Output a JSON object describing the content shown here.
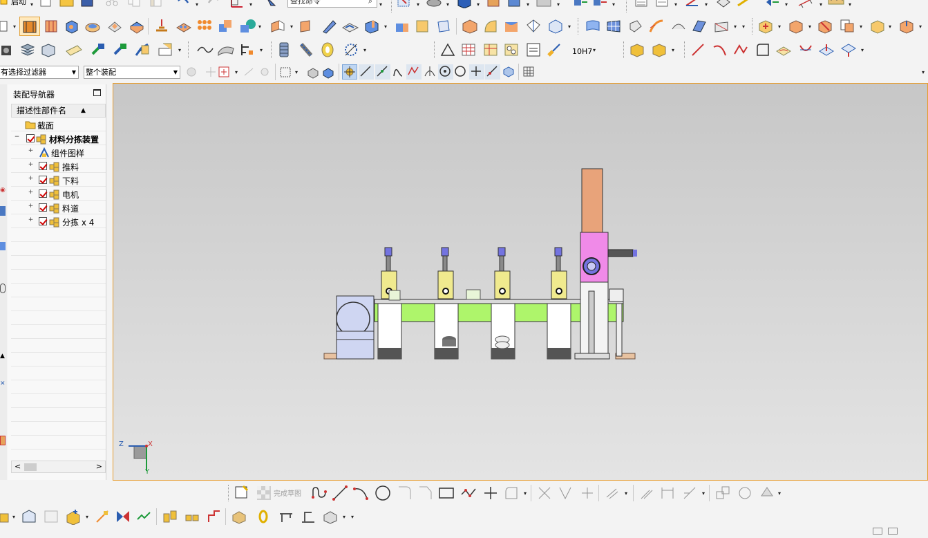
{
  "toolbar": {
    "start_label": "启动",
    "command_search_placeholder": "查找命令",
    "selection_filter": "有选择过滤器",
    "assembly_scope": "整个装配",
    "tolerance_label": "10H7"
  },
  "navigator": {
    "title": "装配导航器",
    "column_header": "描述性部件名",
    "items": [
      {
        "label": "截面",
        "kind": "folder",
        "indent": 1,
        "expander": "",
        "checked": false
      },
      {
        "label": "材料分拣装置",
        "kind": "assembly-root",
        "indent": 0,
        "expander": "−",
        "checked": true,
        "bold": true
      },
      {
        "label": "组件图样",
        "kind": "drawing",
        "indent": 1,
        "expander": "+",
        "checked": false
      },
      {
        "label": "推料",
        "kind": "assembly",
        "indent": 1,
        "expander": "+",
        "checked": true
      },
      {
        "label": "下料",
        "kind": "assembly",
        "indent": 1,
        "expander": "+",
        "checked": true
      },
      {
        "label": "电机",
        "kind": "assembly",
        "indent": 1,
        "expander": "+",
        "checked": true
      },
      {
        "label": "料道",
        "kind": "assembly",
        "indent": 1,
        "expander": "+",
        "checked": true
      },
      {
        "label": "分拣 x 4",
        "kind": "assembly",
        "indent": 1,
        "expander": "+",
        "checked": true
      }
    ]
  },
  "viewport": {
    "triad": {
      "z_label": "Z",
      "x_label": "X",
      "y_label": "Y"
    }
  },
  "sketch_toolbar": {
    "finish_sketch_label": "完成草图"
  },
  "colors": {
    "viewport_border": "#e79c2d",
    "rail": "#aef56b",
    "sensor": "#f0ea8e",
    "cylinder_top": "#e8a37a",
    "cylinder_body": "#f08ae8",
    "check_red": "#d00000"
  }
}
